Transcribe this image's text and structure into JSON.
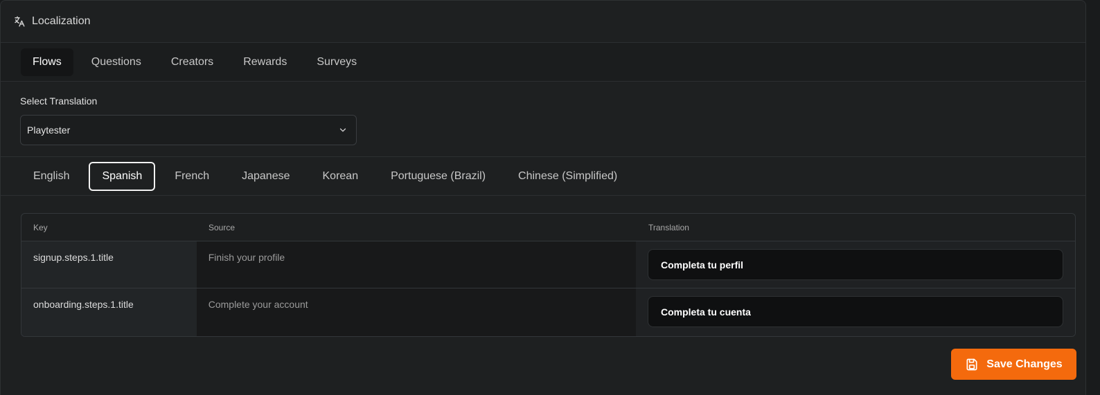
{
  "header": {
    "title": "Localization",
    "icon": "translate-icon"
  },
  "tabs": [
    {
      "label": "Flows",
      "active": true
    },
    {
      "label": "Questions",
      "active": false
    },
    {
      "label": "Creators",
      "active": false
    },
    {
      "label": "Rewards",
      "active": false
    },
    {
      "label": "Surveys",
      "active": false
    }
  ],
  "select": {
    "label": "Select Translation",
    "value": "Playtester"
  },
  "languages": [
    {
      "label": "English",
      "active": false
    },
    {
      "label": "Spanish",
      "active": true
    },
    {
      "label": "French",
      "active": false
    },
    {
      "label": "Japanese",
      "active": false
    },
    {
      "label": "Korean",
      "active": false
    },
    {
      "label": "Portuguese (Brazil)",
      "active": false
    },
    {
      "label": "Chinese (Simplified)",
      "active": false
    }
  ],
  "table": {
    "headers": {
      "key": "Key",
      "source": "Source",
      "translation": "Translation"
    },
    "rows": [
      {
        "key": "signup.steps.1.title",
        "source": "Finish your profile",
        "translation": "Completa tu perfil"
      },
      {
        "key": "onboarding.steps.1.title",
        "source": "Complete your account",
        "translation": "Completa tu cuenta"
      }
    ]
  },
  "save_button": {
    "label": "Save Changes",
    "color": "#f46a0d"
  }
}
